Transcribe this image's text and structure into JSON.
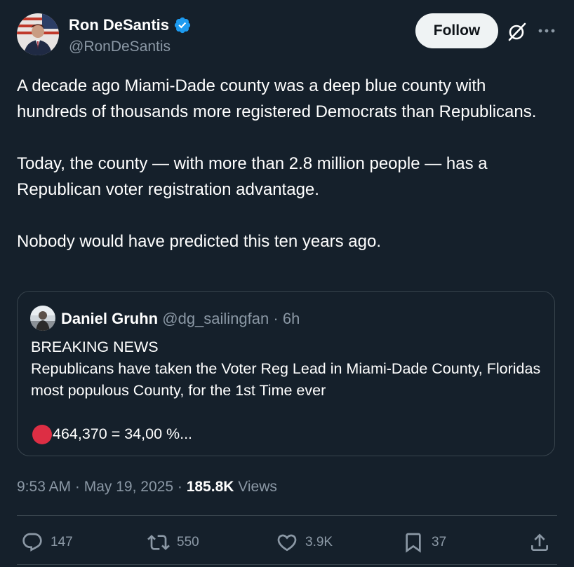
{
  "author": {
    "display_name": "Ron DeSantis",
    "handle": "@RonDeSantis",
    "verified_icon": "verified-badge-icon",
    "follow_label": "Follow"
  },
  "tweet": {
    "paragraphs": [
      "A decade ago Miami-Dade county was a deep blue county with hundreds of thousands more registered Democrats than Republicans.",
      "Today, the county — with more than 2.8 million people — has a Republican voter registration advantage.",
      "Nobody would have predicted this ten years ago."
    ]
  },
  "quote": {
    "display_name": "Daniel Gruhn",
    "handle": "@dg_sailingfan",
    "separator": "·",
    "time": "6h",
    "lines": [
      "BREAKING NEWS",
      "Republicans have taken the Voter Reg Lead in Miami-Dade County, Floridas most populous County, for the 1st Time ever"
    ],
    "stat_text": "464,370 = 34,00 %..."
  },
  "meta": {
    "time": "9:53 AM",
    "sep1": "·",
    "date": "May 19, 2025",
    "sep2": "·",
    "views_count": "185.8K",
    "views_label": "Views"
  },
  "actions": {
    "replies": "147",
    "reposts": "550",
    "likes": "3.9K",
    "bookmarks": "37"
  },
  "colors": {
    "background": "#15202b",
    "text": "#ffffff",
    "muted": "#8b98a5",
    "verified": "#1d9bf0",
    "border": "#38444d",
    "follow_bg": "#eff3f4",
    "red_circle": "#dd2e44"
  }
}
